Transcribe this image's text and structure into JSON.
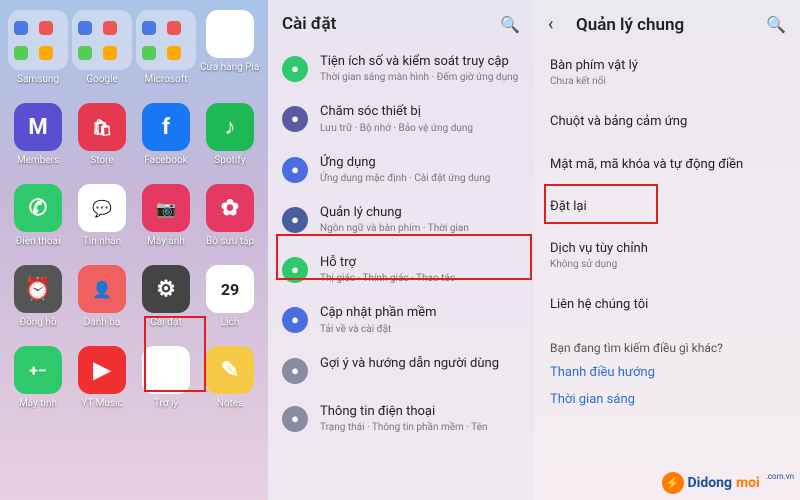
{
  "panel1": {
    "apps": [
      {
        "label": "Samsung",
        "type": "folder"
      },
      {
        "label": "Google",
        "type": "folder"
      },
      {
        "label": "Microsoft",
        "type": "folder"
      },
      {
        "label": "Cửa hàng Play",
        "bg": "#fff",
        "glyph": "▶"
      },
      {
        "label": "Members",
        "bg": "#5a4fd0",
        "glyph": "M"
      },
      {
        "label": "Store",
        "bg": "#e53950",
        "glyph": "🛍"
      },
      {
        "label": "Facebook",
        "bg": "#1877f2",
        "glyph": "f"
      },
      {
        "label": "Spotify",
        "bg": "#1db954",
        "glyph": "♪"
      },
      {
        "label": "Điện thoại",
        "bg": "#2dc96b",
        "glyph": "✆"
      },
      {
        "label": "Tin nhắn",
        "bg": "#ffffff",
        "glyph": "💬"
      },
      {
        "label": "Máy ảnh",
        "bg": "#e63962",
        "glyph": "📷"
      },
      {
        "label": "Bộ sưu tập",
        "bg": "#e63962",
        "glyph": "✿"
      },
      {
        "label": "Đồng hồ",
        "bg": "#555",
        "glyph": "⏰"
      },
      {
        "label": "Danh bạ",
        "bg": "#f06060",
        "glyph": "👤"
      },
      {
        "label": "Cài đặt",
        "bg": "#444",
        "glyph": "⚙"
      },
      {
        "label": "Lịch",
        "bg": "#fff",
        "glyph": "29",
        "text": "#222"
      },
      {
        "label": "Máy tính",
        "bg": "#2dc96b",
        "glyph": "+−"
      },
      {
        "label": "YT Music",
        "bg": "#f03030",
        "glyph": "▶"
      },
      {
        "label": "Trợ lý",
        "bg": "#fff",
        "glyph": "◐"
      },
      {
        "label": "Notes",
        "bg": "#f5c944",
        "glyph": "✎"
      }
    ]
  },
  "panel2": {
    "title": "Cài đặt",
    "items": [
      {
        "icon_bg": "#2dc96b",
        "label": "Tiện ích số và kiểm soát truy cập",
        "sub": "Thời gian sáng màn hình · Đếm giờ ứng dụng"
      },
      {
        "icon_bg": "#5a5aa0",
        "label": "Chăm sóc thiết bị",
        "sub": "Lưu trữ · Bộ nhớ · Bảo vệ ứng dụng"
      },
      {
        "icon_bg": "#4a6de0",
        "label": "Ứng dụng",
        "sub": "Ứng dụng mặc định · Cài đặt ứng dụng"
      },
      {
        "icon_bg": "#4a5ca0",
        "label": "Quản lý chung",
        "sub": "Ngôn ngữ và bàn phím · Thời gian"
      },
      {
        "icon_bg": "#2dc96b",
        "label": "Hỗ trợ",
        "sub": "Thị giác · Thính giác · Thao tác"
      },
      {
        "icon_bg": "#4a6de0",
        "label": "Cập nhật phần mềm",
        "sub": "Tải về và cài đặt"
      },
      {
        "icon_bg": "#8a8aa0",
        "label": "Gợi ý và hướng dẫn người dùng",
        "sub": ""
      },
      {
        "icon_bg": "#8a8aa0",
        "label": "Thông tin điện thoại",
        "sub": "Trạng thái · Thông tin phần mềm · Tên"
      }
    ]
  },
  "panel3": {
    "title": "Quản lý chung",
    "items": [
      {
        "label": "Bàn phím vật lý",
        "sub": "Chưa kết nối"
      },
      {
        "label": "Chuột và bảng cảm ứng",
        "sub": ""
      },
      {
        "label": "Mật mã, mã khóa và tự động điền",
        "sub": ""
      },
      {
        "label": "Đặt lại",
        "sub": ""
      },
      {
        "label": "Dịch vụ tùy chỉnh",
        "sub": "Không sử dụng"
      },
      {
        "label": "Liên hệ chúng tôi",
        "sub": ""
      }
    ],
    "question": "Bạn đang tìm kiếm điều gì khác?",
    "links": [
      "Thanh điều hướng",
      "Thời gian sáng"
    ]
  },
  "watermark": {
    "brand1": "Didong",
    "brand2": "moi",
    "sub": ".com.vn"
  }
}
